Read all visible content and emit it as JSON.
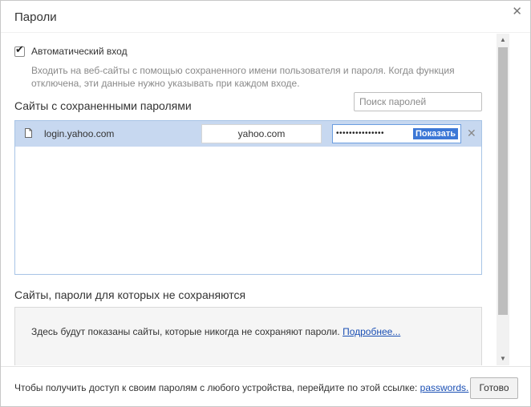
{
  "dialog": {
    "title": "Пароли",
    "close_icon": "close-icon"
  },
  "autologin": {
    "checked": true,
    "label": "Автоматический вход",
    "description": "Входить на веб-сайты с помощью сохраненного имени пользователя и пароля. Когда функция отключена, эти данные нужно указывать при каждом входе."
  },
  "saved_passwords": {
    "section_title": "Сайты с сохраненными паролями",
    "search_placeholder": "Поиск паролей",
    "rows": [
      {
        "site": "login.yahoo.com",
        "username": "yahoo.com",
        "password_masked": "•••••••••••••••",
        "show_label": "Показать",
        "site_icon": "document-icon"
      }
    ]
  },
  "never_saved": {
    "section_title": "Сайты, пароли для которых не сохраняются",
    "text": "Здесь будут показаны сайты, которые никогда не сохраняют пароли.",
    "link": "Подробнее..."
  },
  "footer": {
    "text": "Чтобы получить доступ к своим паролям с любого устройства, перейдите по этой ссылке:",
    "link": "passwords.",
    "done_label": "Готово"
  },
  "colors": {
    "selected_row": "#c7d8f0",
    "show_button": "#3d78d6",
    "link": "#1a4fb4"
  }
}
